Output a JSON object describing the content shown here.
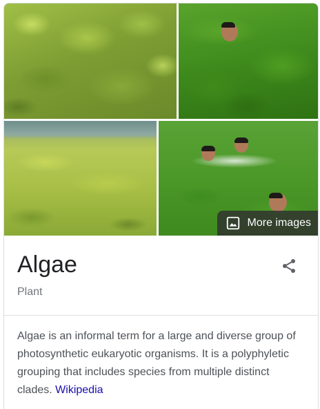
{
  "images": {
    "more_images_label": "More images",
    "items": [
      {
        "subject": "algae-closeup"
      },
      {
        "subject": "man-in-algae"
      },
      {
        "subject": "algae-covered-water"
      },
      {
        "subject": "children-swimming-in-algae"
      }
    ]
  },
  "entity": {
    "title": "Algae",
    "subtitle": "Plant",
    "description": "Algae is an informal term for a large and diverse group of photosynthetic eukaryotic organisms. It is a polyphyletic grouping that includes species from multiple distinct clades.",
    "source_link": "Wikipedia"
  },
  "icons": {
    "more_images": "image-icon",
    "share": "share-icon"
  },
  "colors": {
    "title": "#202124",
    "subtitle": "#70757a",
    "body_text": "#4d5156",
    "link": "#1a0dab",
    "overlay": "#303030"
  }
}
